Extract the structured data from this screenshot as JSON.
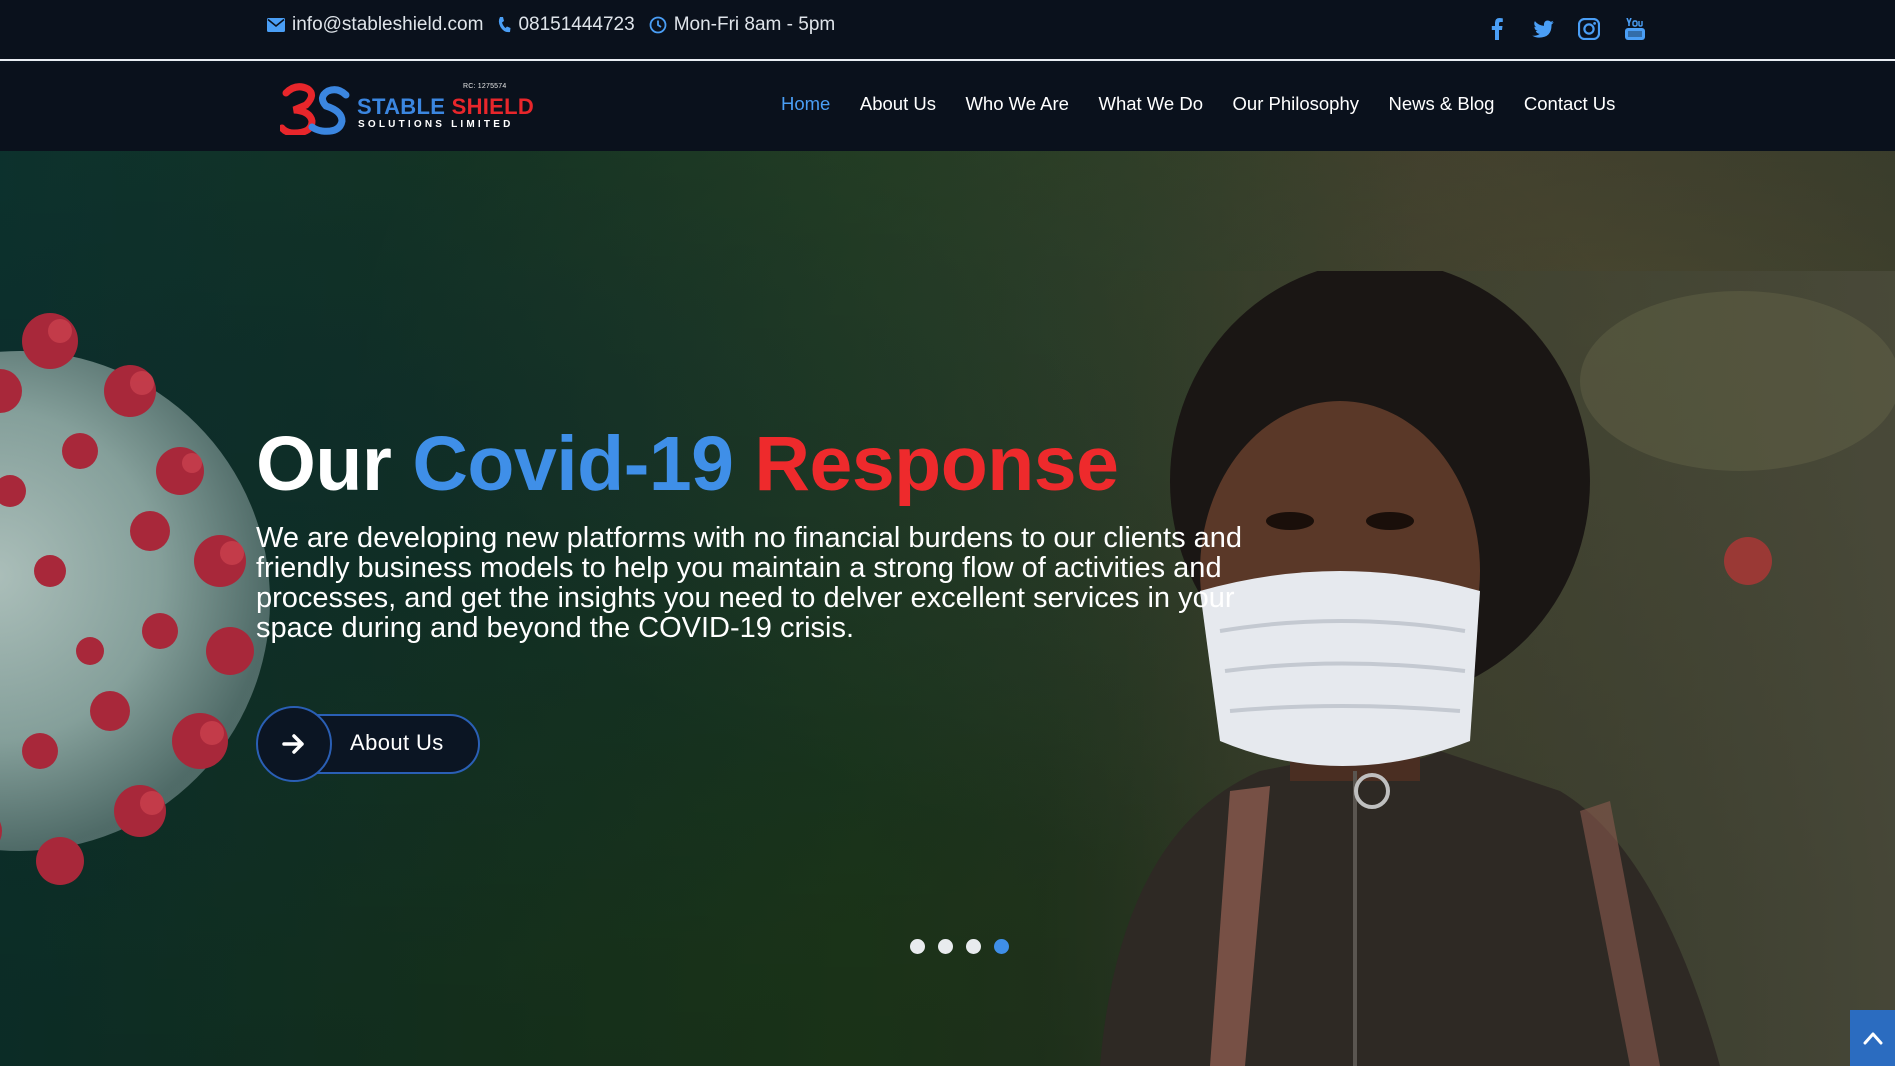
{
  "topbar": {
    "email": "info@stableshield.com",
    "phone": "08151444723",
    "hours": "Mon-Fri 8am - 5pm",
    "social": [
      "facebook-icon",
      "twitter-icon",
      "instagram-icon",
      "youtube-icon"
    ]
  },
  "logo": {
    "rc": "RC: 1275574",
    "brand_part1": "STABLE",
    "brand_part2": "SHIELD",
    "subtitle": "SOLUTIONS LIMITED"
  },
  "nav": {
    "items": [
      {
        "label": "Home",
        "active": true
      },
      {
        "label": "About Us",
        "active": false
      },
      {
        "label": "Who We Are",
        "active": false
      },
      {
        "label": "What We Do",
        "active": false
      },
      {
        "label": "Our Philosophy",
        "active": false
      },
      {
        "label": "News & Blog",
        "active": false
      },
      {
        "label": "Contact Us",
        "active": false
      }
    ]
  },
  "hero": {
    "title_word1": "Our",
    "title_word2": "Covid-19",
    "title_word3": "Response",
    "description": "We are developing new platforms with no financial burdens to our clients and friendly business models to help you maintain a strong flow of activities and processes, and get the insights you need to delver excellent services in your space during and beyond the COVID-19 crisis.",
    "cta_label": "About Us",
    "slides": 4,
    "active_slide": 4
  },
  "colors": {
    "accent_blue": "#3f8fe8",
    "accent_red": "#ee2a2c",
    "bar_bg": "#0a111c"
  }
}
